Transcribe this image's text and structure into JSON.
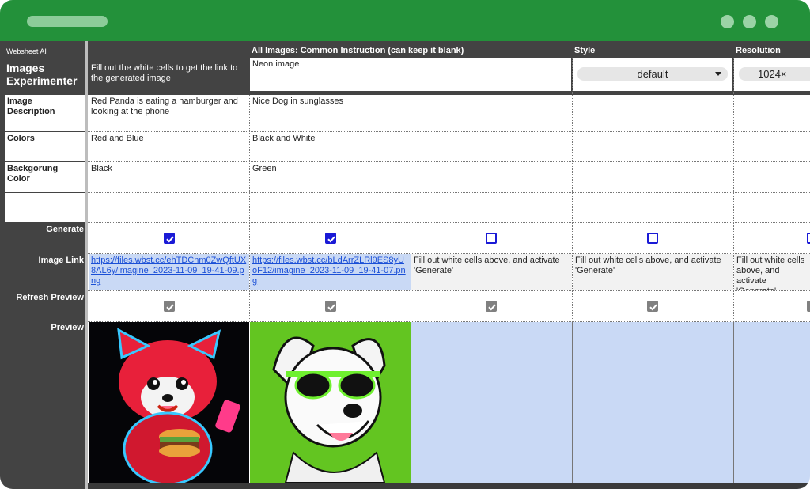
{
  "colors": {
    "titlebar": "#23913a",
    "sidebar": "#434343",
    "preview_empty": "#c9d9f5",
    "accent": "#1a1ad6"
  },
  "brand": {
    "small": "Websheet AI",
    "title": "Images Experimenter"
  },
  "instruction_hint": "Fill out the white cells to get the link to the generated image",
  "headers": {
    "common": "All Images: Common Instruction (can keep it  blank)",
    "style": "Style",
    "resolution": "Resolution"
  },
  "common_value": "Neon image",
  "style_value": "default",
  "resolution_value": "1024×",
  "fields": [
    {
      "label": "Image Description",
      "values": [
        "Red Panda is eating a hamburger and looking at the phone",
        "Nice Dog in sunglasses",
        "",
        "",
        ""
      ]
    },
    {
      "label": "Colors",
      "values": [
        "Red and Blue",
        "Black and White",
        "",
        "",
        ""
      ]
    },
    {
      "label": "Backgorung Color",
      "values": [
        "Black",
        "Green",
        "",
        "",
        ""
      ]
    }
  ],
  "row_labels": {
    "generate": "Generate",
    "image_link": "Image Link",
    "refresh": "Refresh Preview",
    "preview": "Preview"
  },
  "generate": [
    true,
    true,
    false,
    false,
    false
  ],
  "links": [
    "https://files.wbst.cc/ehTDCnm0ZwQftUX8AL6y/imagine_2023-11-09_19-41-09.png",
    "https://files.wbst.cc/bLdArrZLRl9ES8yUoF12/imagine_2023-11-09_19-41-07.png",
    "Fill out white cells above, and activate 'Generate'",
    "Fill out white cells above, and activate 'Generate'",
    "Fill out white cells above, and activate 'Generate'"
  ],
  "previews": [
    "red-panda-neon-image",
    "dog-sunglasses-neon-image",
    "",
    "",
    ""
  ]
}
